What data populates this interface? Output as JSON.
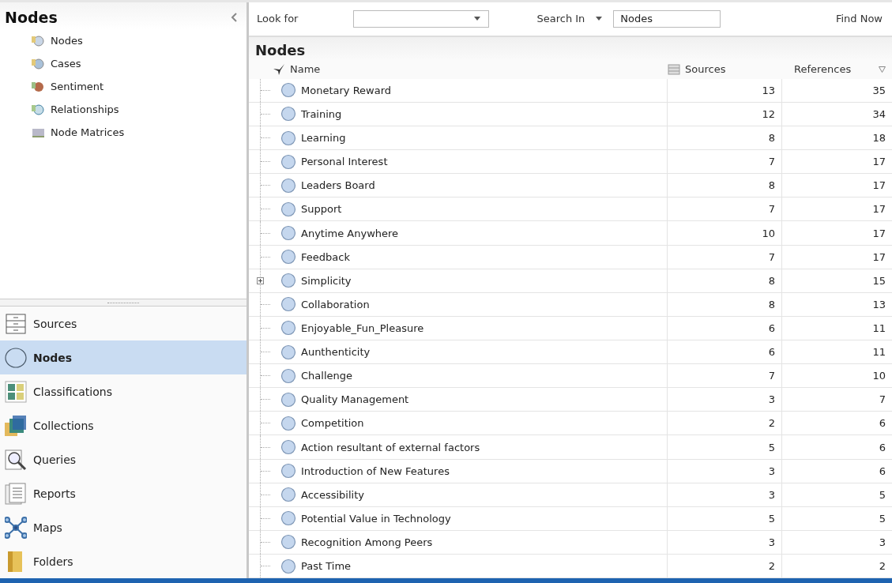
{
  "sidebar": {
    "title": "Nodes",
    "items": [
      {
        "label": "Nodes",
        "kind": "node"
      },
      {
        "label": "Cases",
        "kind": "case"
      },
      {
        "label": "Sentiment",
        "kind": "sentiment"
      },
      {
        "label": "Relationships",
        "kind": "relationship"
      },
      {
        "label": "Node Matrices",
        "kind": "matrix"
      }
    ],
    "navigation": [
      {
        "label": "Sources",
        "kind": "sources",
        "selected": false
      },
      {
        "label": "Nodes",
        "kind": "nodes",
        "selected": true
      },
      {
        "label": "Classifications",
        "kind": "classifications",
        "selected": false
      },
      {
        "label": "Collections",
        "kind": "collections",
        "selected": false
      },
      {
        "label": "Queries",
        "kind": "queries",
        "selected": false
      },
      {
        "label": "Reports",
        "kind": "reports",
        "selected": false
      },
      {
        "label": "Maps",
        "kind": "maps",
        "selected": false
      },
      {
        "label": "Folders",
        "kind": "folders",
        "selected": false
      }
    ]
  },
  "find_bar": {
    "look_for_label": "Look for",
    "search_in_label": "Search In",
    "search_in_value": "Nodes",
    "find_button": "Find Now"
  },
  "list": {
    "title": "Nodes",
    "columns": [
      "Name",
      "Sources",
      "References"
    ],
    "rows": [
      {
        "name": "Monetary Reward",
        "sources": "13",
        "references": "35",
        "expandable": false
      },
      {
        "name": "Training",
        "sources": "12",
        "references": "34",
        "expandable": false
      },
      {
        "name": "Learning",
        "sources": "8",
        "references": "18",
        "expandable": false
      },
      {
        "name": "Personal Interest",
        "sources": "7",
        "references": "17",
        "expandable": false
      },
      {
        "name": "Leaders Board",
        "sources": "8",
        "references": "17",
        "expandable": false
      },
      {
        "name": "Support",
        "sources": "7",
        "references": "17",
        "expandable": false
      },
      {
        "name": "Anytime Anywhere",
        "sources": "10",
        "references": "17",
        "expandable": false
      },
      {
        "name": "Feedback",
        "sources": "7",
        "references": "17",
        "expandable": false
      },
      {
        "name": "Simplicity",
        "sources": "8",
        "references": "15",
        "expandable": true
      },
      {
        "name": "Collaboration",
        "sources": "8",
        "references": "13",
        "expandable": false
      },
      {
        "name": "Enjoyable_Fun_Pleasure",
        "sources": "6",
        "references": "11",
        "expandable": false
      },
      {
        "name": "Aunthenticity",
        "sources": "6",
        "references": "11",
        "expandable": false
      },
      {
        "name": "Challenge",
        "sources": "7",
        "references": "10",
        "expandable": false
      },
      {
        "name": "Quality Management",
        "sources": "3",
        "references": "7",
        "expandable": false
      },
      {
        "name": "Competition",
        "sources": "2",
        "references": "6",
        "expandable": false
      },
      {
        "name": "Action resultant of external factors",
        "sources": "5",
        "references": "6",
        "expandable": false
      },
      {
        "name": "Introduction of New Features",
        "sources": "3",
        "references": "6",
        "expandable": false
      },
      {
        "name": "Accessibility",
        "sources": "3",
        "references": "5",
        "expandable": false
      },
      {
        "name": "Potential Value in Technology",
        "sources": "5",
        "references": "5",
        "expandable": false
      },
      {
        "name": "Recognition Among Peers",
        "sources": "3",
        "references": "3",
        "expandable": false
      },
      {
        "name": "Past Time",
        "sources": "2",
        "references": "2",
        "expandable": false
      }
    ]
  }
}
